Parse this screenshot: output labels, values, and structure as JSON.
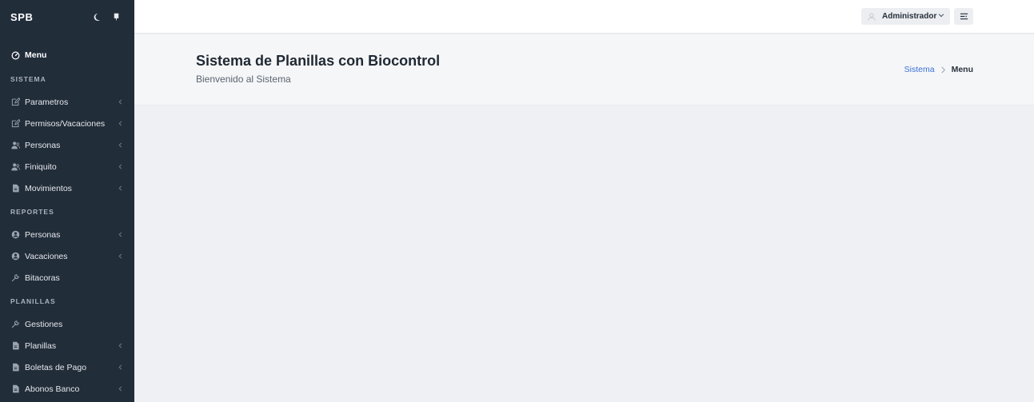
{
  "brand": "SPB",
  "topbar": {
    "user_label": "Administrador"
  },
  "sidebar": {
    "menu_label": "Menu",
    "sections": [
      {
        "title": "SISTEMA",
        "items": [
          {
            "label": "Parametros",
            "icon": "edit-icon",
            "has_submenu": true
          },
          {
            "label": "Permisos/Vacaciones",
            "icon": "edit-icon",
            "has_submenu": true
          },
          {
            "label": "Personas",
            "icon": "users-icon",
            "has_submenu": true
          },
          {
            "label": "Finiquito",
            "icon": "users-icon",
            "has_submenu": true
          },
          {
            "label": "Movimientos",
            "icon": "file-icon",
            "has_submenu": true
          }
        ]
      },
      {
        "title": "REPORTES",
        "items": [
          {
            "label": "Personas",
            "icon": "user-circle-icon",
            "has_submenu": true
          },
          {
            "label": "Vacaciones",
            "icon": "user-circle-icon",
            "has_submenu": true
          },
          {
            "label": "Bitacoras",
            "icon": "wrench-icon",
            "has_submenu": false
          }
        ]
      },
      {
        "title": "PLANILLAS",
        "items": [
          {
            "label": "Gestiones",
            "icon": "wrench-icon",
            "has_submenu": false
          },
          {
            "label": "Planillas",
            "icon": "file-icon",
            "has_submenu": true
          },
          {
            "label": "Boletas de Pago",
            "icon": "file-icon",
            "has_submenu": true
          },
          {
            "label": "Abonos Banco",
            "icon": "file-icon",
            "has_submenu": true
          }
        ]
      }
    ]
  },
  "hero": {
    "title": "Sistema de Planillas con Biocontrol",
    "subtitle": "Bienvenido al Sistema"
  },
  "breadcrumb": {
    "parent": "Sistema",
    "current": "Menu"
  },
  "colors": {
    "sidebar_bg": "#222d3a",
    "link": "#3a6fd8",
    "page_bg": "#eef0f3"
  }
}
